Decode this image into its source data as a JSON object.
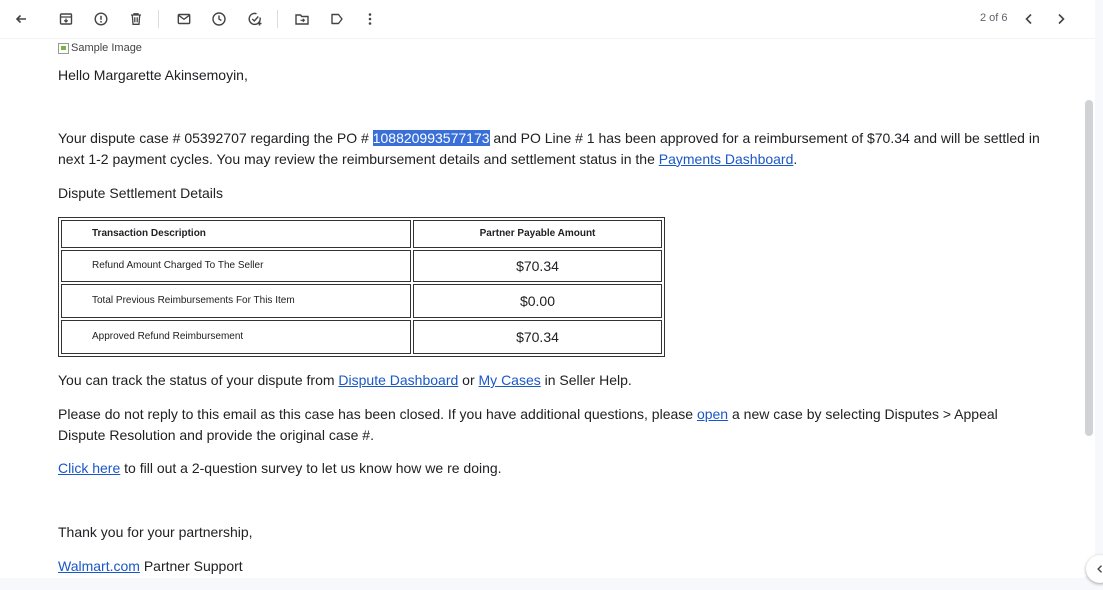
{
  "toolbar": {
    "buttons": [
      "back-icon",
      "archive-icon",
      "report-spam-icon",
      "delete-icon",
      "mark-unread-icon",
      "snooze-icon",
      "add-task-icon",
      "move-to-icon",
      "label-icon",
      "more-vert-icon"
    ],
    "counter": "2 of 6"
  },
  "email": {
    "image_alt": "Sample Image",
    "greeting": "Hello Margarette Akinsemoyin,",
    "para1": {
      "t1": "Your dispute case # 05392707 regarding the PO # ",
      "po": "108820993577173",
      "t2": " and PO Line # 1 has been approved for a reimbursement of   $70.34 and will be settled in next 1-2 payment cycles. You may review the reimbursement details and settlement status in the ",
      "link": "Payments Dashboard",
      "t3": "."
    },
    "section_title": "Dispute Settlement Details",
    "table": {
      "headers": [
        "Transaction Description",
        "Partner Payable Amount"
      ],
      "rows": [
        [
          "Refund Amount Charged To The Seller",
          "$70.34"
        ],
        [
          "Total Previous Reimbursements For This Item",
          "$0.00"
        ],
        [
          "Approved Refund Reimbursement",
          "$70.34"
        ]
      ]
    },
    "para2": {
      "t1": "You can track the status of your dispute from ",
      "link1": "Dispute Dashboard",
      "t2": " or ",
      "link2": "My Cases",
      "t3": " in Seller Help."
    },
    "para3": {
      "t1": "Please do not reply to this email as this case has been closed. If you have additional questions, please ",
      "link": "open",
      "t2": " a new case by selecting Disputes > Appeal Dispute Resolution and provide the original case #."
    },
    "para4": {
      "link": "Click here",
      "t1": " to fill out a 2-question survey to let us know how we re doing."
    },
    "closing": "Thank you for your partnership,",
    "signature": {
      "link": "Walmart.com",
      "t1": " Partner Support"
    }
  }
}
